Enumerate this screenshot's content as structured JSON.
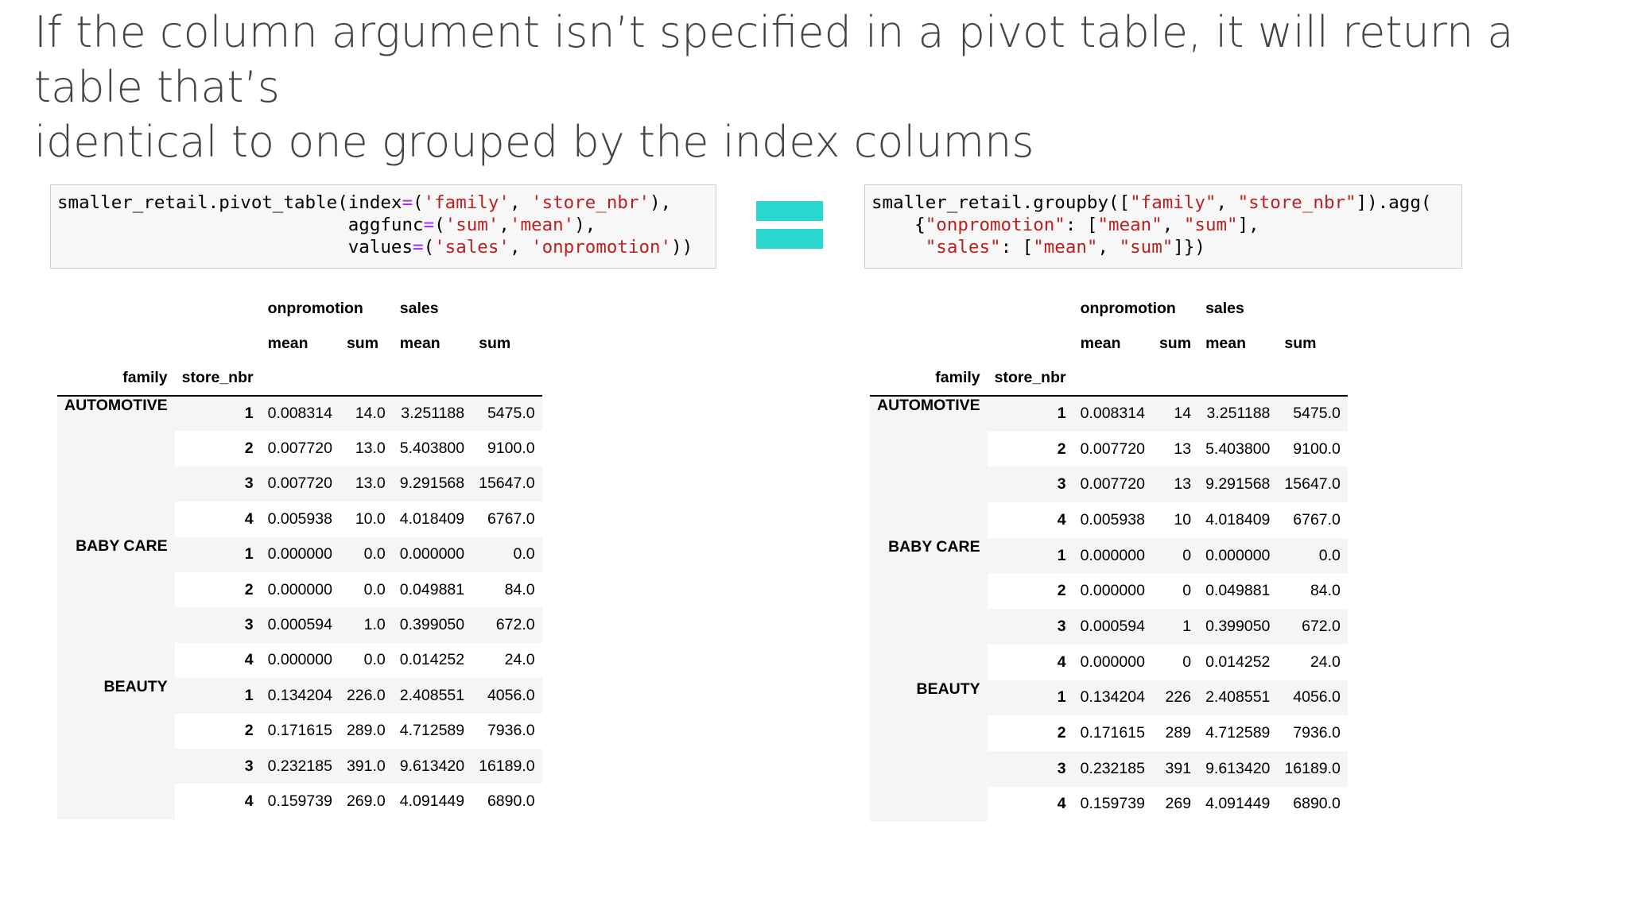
{
  "slide": {
    "title_line1": "If the column argument isn’t specified in a pivot table, it will return a table that’s",
    "title_line2": "identical to one grouped by the index columns"
  },
  "code_left": {
    "lines": [
      [
        {
          "t": "smaller_retail.pivot_table(index",
          "k": "plain"
        },
        {
          "t": "=",
          "k": "op"
        },
        {
          "t": "(",
          "k": "plain"
        },
        {
          "t": "'family'",
          "k": "str"
        },
        {
          "t": ", ",
          "k": "plain"
        },
        {
          "t": "'store_nbr'",
          "k": "str"
        },
        {
          "t": "),",
          "k": "plain"
        }
      ],
      [
        {
          "t": "                           aggfunc",
          "k": "plain"
        },
        {
          "t": "=",
          "k": "op"
        },
        {
          "t": "(",
          "k": "plain"
        },
        {
          "t": "'sum'",
          "k": "str"
        },
        {
          "t": ",",
          "k": "plain"
        },
        {
          "t": "'mean'",
          "k": "str"
        },
        {
          "t": "),",
          "k": "plain"
        }
      ],
      [
        {
          "t": "                           values",
          "k": "plain"
        },
        {
          "t": "=",
          "k": "op"
        },
        {
          "t": "(",
          "k": "plain"
        },
        {
          "t": "'sales'",
          "k": "str"
        },
        {
          "t": ", ",
          "k": "plain"
        },
        {
          "t": "'onpromotion'",
          "k": "str"
        },
        {
          "t": "))",
          "k": "plain"
        }
      ]
    ]
  },
  "code_right": {
    "lines": [
      [
        {
          "t": "smaller_retail.groupby([",
          "k": "plain"
        },
        {
          "t": "\"family\"",
          "k": "str"
        },
        {
          "t": ", ",
          "k": "plain"
        },
        {
          "t": "\"store_nbr\"",
          "k": "str"
        },
        {
          "t": "]).agg(",
          "k": "plain"
        }
      ],
      [
        {
          "t": "    {",
          "k": "plain"
        },
        {
          "t": "\"onpromotion\"",
          "k": "str"
        },
        {
          "t": ": [",
          "k": "plain"
        },
        {
          "t": "\"mean\"",
          "k": "str"
        },
        {
          "t": ", ",
          "k": "plain"
        },
        {
          "t": "\"sum\"",
          "k": "str"
        },
        {
          "t": "],",
          "k": "plain"
        }
      ],
      [
        {
          "t": "     ",
          "k": "plain"
        },
        {
          "t": "\"sales\"",
          "k": "str"
        },
        {
          "t": ": [",
          "k": "plain"
        },
        {
          "t": "\"mean\"",
          "k": "str"
        },
        {
          "t": ", ",
          "k": "plain"
        },
        {
          "t": "\"sum\"",
          "k": "str"
        },
        {
          "t": "]})",
          "k": "plain"
        }
      ]
    ]
  },
  "table_left": {
    "col_groups": [
      "onpromotion",
      "sales"
    ],
    "sub_cols": [
      "mean",
      "sum",
      "mean",
      "sum"
    ],
    "index_names": [
      "family",
      "store_nbr"
    ],
    "groups": [
      {
        "family": "AUTOMOTIVE",
        "rows": [
          {
            "store": "1",
            "cells": [
              "0.008314",
              "14.0",
              "3.251188",
              "5475.0"
            ]
          },
          {
            "store": "2",
            "cells": [
              "0.007720",
              "13.0",
              "5.403800",
              "9100.0"
            ]
          },
          {
            "store": "3",
            "cells": [
              "0.007720",
              "13.0",
              "9.291568",
              "15647.0"
            ]
          },
          {
            "store": "4",
            "cells": [
              "0.005938",
              "10.0",
              "4.018409",
              "6767.0"
            ]
          }
        ]
      },
      {
        "family": "BABY CARE",
        "rows": [
          {
            "store": "1",
            "cells": [
              "0.000000",
              "0.0",
              "0.000000",
              "0.0"
            ]
          },
          {
            "store": "2",
            "cells": [
              "0.000000",
              "0.0",
              "0.049881",
              "84.0"
            ]
          },
          {
            "store": "3",
            "cells": [
              "0.000594",
              "1.0",
              "0.399050",
              "672.0"
            ]
          },
          {
            "store": "4",
            "cells": [
              "0.000000",
              "0.0",
              "0.014252",
              "24.0"
            ]
          }
        ]
      },
      {
        "family": "BEAUTY",
        "rows": [
          {
            "store": "1",
            "cells": [
              "0.134204",
              "226.0",
              "2.408551",
              "4056.0"
            ]
          },
          {
            "store": "2",
            "cells": [
              "0.171615",
              "289.0",
              "4.712589",
              "7936.0"
            ]
          },
          {
            "store": "3",
            "cells": [
              "0.232185",
              "391.0",
              "9.613420",
              "16189.0"
            ]
          },
          {
            "store": "4",
            "cells": [
              "0.159739",
              "269.0",
              "4.091449",
              "6890.0"
            ]
          }
        ]
      }
    ]
  },
  "table_right": {
    "col_groups": [
      "onpromotion",
      "sales"
    ],
    "sub_cols": [
      "mean",
      "sum",
      "mean",
      "sum"
    ],
    "index_names": [
      "family",
      "store_nbr"
    ],
    "groups": [
      {
        "family": "AUTOMOTIVE",
        "rows": [
          {
            "store": "1",
            "cells": [
              "0.008314",
              "14",
              "3.251188",
              "5475.0"
            ]
          },
          {
            "store": "2",
            "cells": [
              "0.007720",
              "13",
              "5.403800",
              "9100.0"
            ]
          },
          {
            "store": "3",
            "cells": [
              "0.007720",
              "13",
              "9.291568",
              "15647.0"
            ]
          },
          {
            "store": "4",
            "cells": [
              "0.005938",
              "10",
              "4.018409",
              "6767.0"
            ]
          }
        ]
      },
      {
        "family": "BABY CARE",
        "rows": [
          {
            "store": "1",
            "cells": [
              "0.000000",
              "0",
              "0.000000",
              "0.0"
            ]
          },
          {
            "store": "2",
            "cells": [
              "0.000000",
              "0",
              "0.049881",
              "84.0"
            ]
          },
          {
            "store": "3",
            "cells": [
              "0.000594",
              "1",
              "0.399050",
              "672.0"
            ]
          },
          {
            "store": "4",
            "cells": [
              "0.000000",
              "0",
              "0.014252",
              "24.0"
            ]
          }
        ]
      },
      {
        "family": "BEAUTY",
        "rows": [
          {
            "store": "1",
            "cells": [
              "0.134204",
              "226",
              "2.408551",
              "4056.0"
            ]
          },
          {
            "store": "2",
            "cells": [
              "0.171615",
              "289",
              "4.712589",
              "7936.0"
            ]
          },
          {
            "store": "3",
            "cells": [
              "0.232185",
              "391",
              "9.613420",
              "16189.0"
            ]
          },
          {
            "store": "4",
            "cells": [
              "0.159739",
              "269",
              "4.091449",
              "6890.0"
            ]
          }
        ]
      }
    ]
  }
}
